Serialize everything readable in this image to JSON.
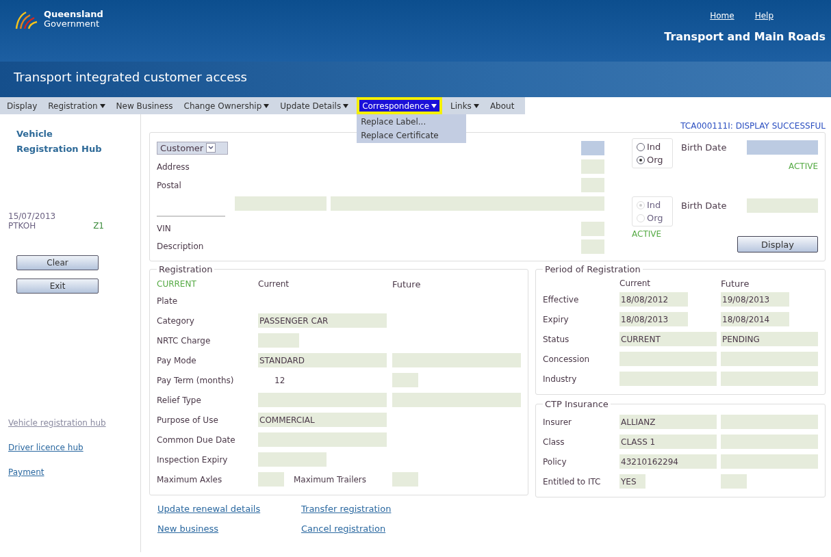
{
  "header": {
    "logo_line1": "Queensland",
    "logo_line2": "Government",
    "links": [
      {
        "label": "Home"
      },
      {
        "label": "Help"
      }
    ],
    "department": "Transport and Main Roads",
    "app_title": "Transport integrated customer access"
  },
  "menu": [
    {
      "label": "Display",
      "caret": false,
      "selected": false
    },
    {
      "label": "Registration",
      "caret": true,
      "selected": false
    },
    {
      "label": "New Business",
      "caret": false,
      "selected": false
    },
    {
      "label": "Change Ownership",
      "caret": true,
      "selected": false
    },
    {
      "label": "Update Details",
      "caret": true,
      "selected": false
    },
    {
      "label": "Correspondence",
      "caret": true,
      "selected": true
    },
    {
      "label": "Links",
      "caret": true,
      "selected": false
    },
    {
      "label": "About",
      "caret": false,
      "selected": false
    }
  ],
  "dropdown": [
    "Replace Label...",
    "Replace Certificate"
  ],
  "status_message": "TCA000111I: DISPLAY SUCCESSFUL",
  "sidebar": {
    "hub_title": [
      "Vehicle",
      "Registration Hub"
    ],
    "date": "15/07/2013",
    "user": "PTKOH",
    "zone": "Z1",
    "buttons": [
      "Clear",
      "Exit"
    ],
    "links": [
      {
        "label": "Vehicle registration hub",
        "visited": true
      },
      {
        "label": "Driver licence hub",
        "visited": false
      },
      {
        "label": "Payment",
        "visited": false
      }
    ]
  },
  "customer": {
    "selector": "Customer",
    "address_labels": [
      "Address",
      "Postal"
    ],
    "vehicle_labels": [
      "VIN",
      "Description"
    ],
    "display_button": "Display",
    "owners": [
      {
        "disabled": false,
        "options": [
          {
            "label": "Ind",
            "selected": false
          },
          {
            "label": "Org",
            "selected": true
          }
        ],
        "birth_date_label": "Birth Date",
        "status": "ACTIVE"
      },
      {
        "disabled": true,
        "options": [
          {
            "label": "Ind",
            "selected": true
          },
          {
            "label": "Org",
            "selected": false
          }
        ],
        "birth_date_label": "Birth Date",
        "status": "ACTIVE"
      }
    ]
  },
  "registration": {
    "title": "Registration",
    "status": "CURRENT",
    "col_current": "Current",
    "col_future": "Future",
    "rows": [
      {
        "label": "Plate",
        "current": {
          "kind": "none"
        },
        "future": {
          "kind": "none"
        }
      },
      {
        "label": "Category",
        "current": {
          "kind": "wide",
          "value": "PASSENGER CAR"
        },
        "future": {
          "kind": "none"
        }
      },
      {
        "label": "NRTC Charge",
        "current": {
          "kind": "narrow"
        },
        "future": {
          "kind": "none"
        }
      },
      {
        "label": "Pay Mode",
        "current": {
          "kind": "wide",
          "value": "STANDARD"
        },
        "future": {
          "kind": "wide"
        }
      },
      {
        "label": "Pay Term (months)",
        "current": {
          "kind": "text",
          "value": "12"
        },
        "future": {
          "kind": "tiny"
        }
      },
      {
        "label": "Relief Type",
        "current": {
          "kind": "wide"
        },
        "future": {
          "kind": "wide"
        }
      },
      {
        "label": "Purpose of Use",
        "current": {
          "kind": "wide",
          "value": "COMMERCIAL"
        },
        "future": {
          "kind": "none"
        }
      },
      {
        "label": "Common Due Date",
        "current": {
          "kind": "wide"
        },
        "future": {
          "kind": "none"
        }
      },
      {
        "label": "Inspection Expiry",
        "current": {
          "kind": "medium"
        },
        "future": {
          "kind": "none"
        }
      }
    ],
    "axles_label": "Maximum Axles",
    "trailers_label": "Maximum Trailers"
  },
  "period": {
    "title": "Period of Registration",
    "col_current": "Current",
    "col_future": "Future",
    "rows": [
      {
        "label": "Effective",
        "current": {
          "kind": "medium",
          "value": "18/08/2012"
        },
        "future": {
          "kind": "medium",
          "value": "19/08/2013"
        }
      },
      {
        "label": "Expiry",
        "current": {
          "kind": "medium",
          "value": "18/08/2013"
        },
        "future": {
          "kind": "medium",
          "value": "18/08/2014"
        }
      },
      {
        "label": "Status",
        "current": {
          "kind": "wide",
          "value": "CURRENT"
        },
        "future": {
          "kind": "wide",
          "value": "PENDING"
        }
      },
      {
        "label": "Concession",
        "current": {
          "kind": "wide"
        },
        "future": {
          "kind": "wide"
        }
      },
      {
        "label": "Industry",
        "current": {
          "kind": "wide"
        },
        "future": {
          "kind": "wide"
        }
      }
    ]
  },
  "ctp": {
    "title": "CTP Insurance",
    "rows": [
      {
        "label": "Insurer",
        "current": {
          "kind": "wide",
          "value": "ALLIANZ"
        },
        "future": {
          "kind": "wide"
        }
      },
      {
        "label": "Class",
        "current": {
          "kind": "wide",
          "value": "CLASS 1"
        },
        "future": {
          "kind": "wide"
        }
      },
      {
        "label": "Policy",
        "current": {
          "kind": "wide",
          "value": "43210162294"
        },
        "future": {
          "kind": "wide"
        }
      },
      {
        "label": "Entitled to ITC",
        "current": {
          "kind": "tiny",
          "value": "YES"
        },
        "future": {
          "kind": "tiny"
        }
      }
    ]
  },
  "actions": [
    "Update renewal details",
    "Transfer registration",
    "New business",
    "Cancel registration"
  ]
}
